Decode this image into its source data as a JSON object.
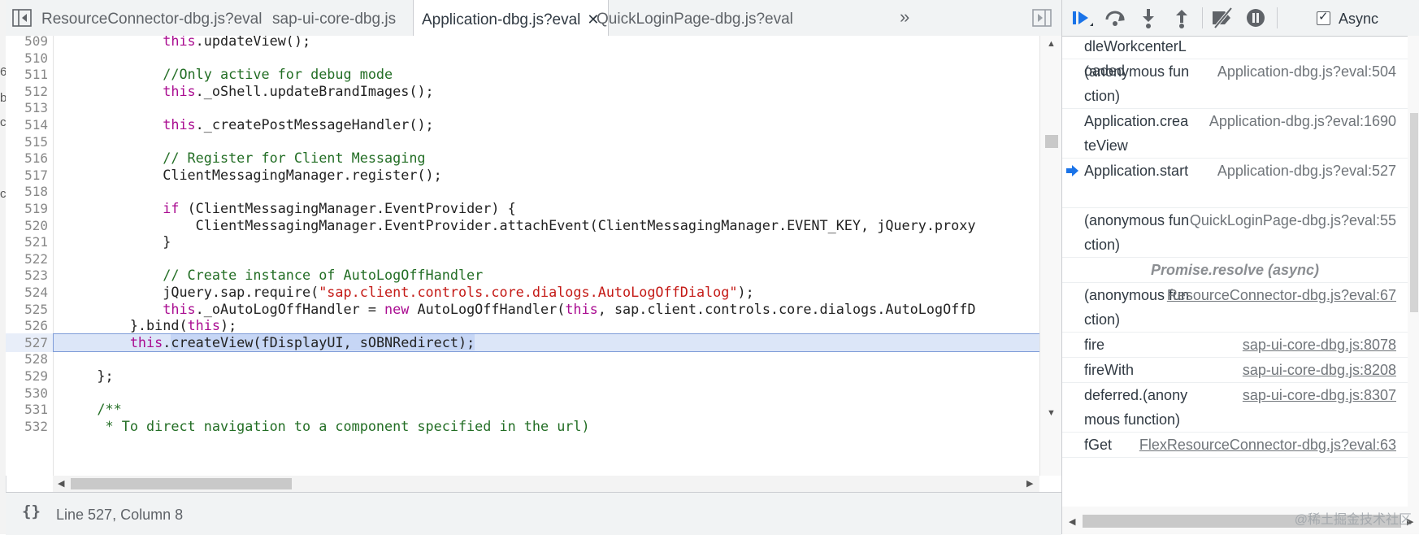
{
  "editor": {
    "tabs": [
      {
        "label": "ResourceConnector-dbg.js?eval",
        "active": false
      },
      {
        "label": "sap-ui-core-dbg.js",
        "active": false
      },
      {
        "label": "Application-dbg.js?eval",
        "active": true
      },
      {
        "label": "QuickLoginPage-dbg.js?eval",
        "active": false
      }
    ],
    "more_tabs_label": "»",
    "current_line": 527,
    "lines": [
      {
        "n": "509",
        "code": "            this.updateView();"
      },
      {
        "n": "510",
        "code": ""
      },
      {
        "n": "511",
        "code": "            //Only active for debug mode"
      },
      {
        "n": "512",
        "code": "            this._oShell.updateBrandImages();"
      },
      {
        "n": "513",
        "code": ""
      },
      {
        "n": "514",
        "code": "            this._createPostMessageHandler();"
      },
      {
        "n": "515",
        "code": ""
      },
      {
        "n": "516",
        "code": "            // Register for Client Messaging"
      },
      {
        "n": "517",
        "code": "            ClientMessagingManager.register();"
      },
      {
        "n": "518",
        "code": ""
      },
      {
        "n": "519",
        "code": "            if (ClientMessagingManager.EventProvider) {"
      },
      {
        "n": "520",
        "code": "                ClientMessagingManager.EventProvider.attachEvent(ClientMessagingManager.EVENT_KEY, jQuery.proxy"
      },
      {
        "n": "521",
        "code": "            }"
      },
      {
        "n": "522",
        "code": ""
      },
      {
        "n": "523",
        "code": "            // Create instance of AutoLogOffHandler"
      },
      {
        "n": "524",
        "code": "            jQuery.sap.require(\"sap.client.controls.core.dialogs.AutoLogOffDialog\");"
      },
      {
        "n": "525",
        "code": "            this._oAutoLogOffHandler = new AutoLogOffHandler(this, sap.client.controls.core.dialogs.AutoLogOffD"
      },
      {
        "n": "526",
        "code": "        }.bind(this);"
      },
      {
        "n": "527",
        "code": "        this.createView(fDisplayUI, sOBNRedirect);"
      },
      {
        "n": "528",
        "code": ""
      },
      {
        "n": "529",
        "code": "    };"
      },
      {
        "n": "530",
        "code": ""
      },
      {
        "n": "531",
        "code": "    /**"
      },
      {
        "n": "532",
        "code": "     * To direct navigation to a component specified in the url)"
      }
    ],
    "status": {
      "braces": "{}",
      "position": "Line 527, Column 8"
    }
  },
  "debugger": {
    "async_label": "Async",
    "async_checked": true,
    "frames": [
      {
        "fn": "dleWorkcenterLoaded",
        "loc": "",
        "link": false,
        "current": false,
        "rows": 1
      },
      {
        "fn": "(anonymous function)",
        "loc": "Application-dbg.js?eval:504",
        "link": false,
        "current": false,
        "rows": 2
      },
      {
        "fn": "Application.createView",
        "loc": "Application-dbg.js?eval:1690",
        "link": false,
        "current": false,
        "rows": 2
      },
      {
        "fn": "Application.start",
        "loc": "Application-dbg.js?eval:527",
        "link": false,
        "current": true,
        "rows": 2
      },
      {
        "fn": "(anonymous function)",
        "loc": "QuickLoginPage-dbg.js?eval:55",
        "link": false,
        "current": false,
        "rows": 2
      }
    ],
    "async_separator": "Promise.resolve (async)",
    "frames_after": [
      {
        "fn": "(anonymous function)",
        "loc": "ResourceConnector-dbg.js?eval:67",
        "link": true,
        "rows": 2
      },
      {
        "fn": "fire",
        "loc": "sap-ui-core-dbg.js:8078",
        "link": true,
        "rows": 1
      },
      {
        "fn": "fireWith",
        "loc": "sap-ui-core-dbg.js:8208",
        "link": true,
        "rows": 1
      },
      {
        "fn": "deferred.(anonymous function)",
        "loc": "sap-ui-core-dbg.js:8307",
        "link": true,
        "rows": 2
      },
      {
        "fn": "fGet",
        "loc": "FlexResourceConnector-dbg.js?eval:63",
        "link": true,
        "rows": 1
      }
    ]
  },
  "watermark": "@稀土掘金技术社区",
  "colors": {
    "keyword": "#aa0d91",
    "comment": "#236e25",
    "string": "#c41a16",
    "selection": "#c6d6f5",
    "accent": "#1a73e8"
  }
}
